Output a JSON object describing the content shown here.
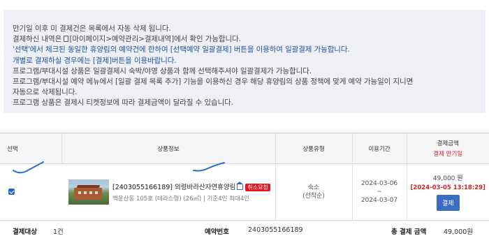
{
  "notice": {
    "lines": [
      "만기일 이후 미 결제건은 목록에서 자동 삭제 됩니다.",
      "[마이페이지>예약관리>결제내역]에서 확인 가능합니다.",
      "'선택'에서 체크된 동일한 휴양림의 예약건에 한하여 [선택예약 일괄결제] 버튼을 이용하여 일괄결제 가능합니다.",
      "개별로 결제하실 경우에는 [결제]버튼을 이용바랍니다.",
      "프로그램/부대시설 상품은 일괄결제시 숙박/야영 상품과 함께 선택해주셔야 일괄결제가 가능합니다.",
      "프로그램/부대시설 예약 메뉴에서 [일괄 결제 목록 추가] 기능을 이용하신 경우 해당 휴양림의 상품 정책에 맞게 예약 가능일이 지니면",
      "자동으로 삭제됩니다.",
      "프로그램 상품은 결제시 티켓정보에 따라 결제금액이 달라질 수 있습니다."
    ],
    "line2_prefix": "결제하신 내역은 "
  },
  "table": {
    "headers": {
      "select": "선택",
      "product": "상품정보",
      "type": "상품유형",
      "period": "이용기간",
      "amount": "결제금액",
      "deadline": "결제 만기일"
    },
    "rows": [
      {
        "checked": true,
        "name": "[2403055166189] 의령바라산자연휴양림",
        "badge": "취소요청",
        "info": "백운산동 105호 (테라스형) (26㎡) | 기준4인 최대4인",
        "type_main": "숙소",
        "type_sub": "(선착순)",
        "period_start": "2024-03-06",
        "period_sep": "~",
        "period_end": "2024-03-07",
        "price": "49,000 원",
        "deadline": "[2024-03-05 13:18:29]",
        "pay_label": "결제"
      }
    ]
  },
  "summary": {
    "target_label": "결제대상",
    "target_value": "1건",
    "resv_label": "예약번호",
    "resv_value": "2403055166189",
    "total_label": "총 결제 금액",
    "total_value": "49,000원"
  },
  "colors": {
    "notice_bg": "#eff0f6",
    "notice_blue": "#1d4f9c",
    "deadline_red": "#d61f1f",
    "badge_red": "#e8161e",
    "pay_button": "#3c6bc4",
    "annotation_blue": "#2a6fd6"
  },
  "icons": [
    "document-icon",
    "home-icon",
    "checkbox-checked-icon"
  ]
}
